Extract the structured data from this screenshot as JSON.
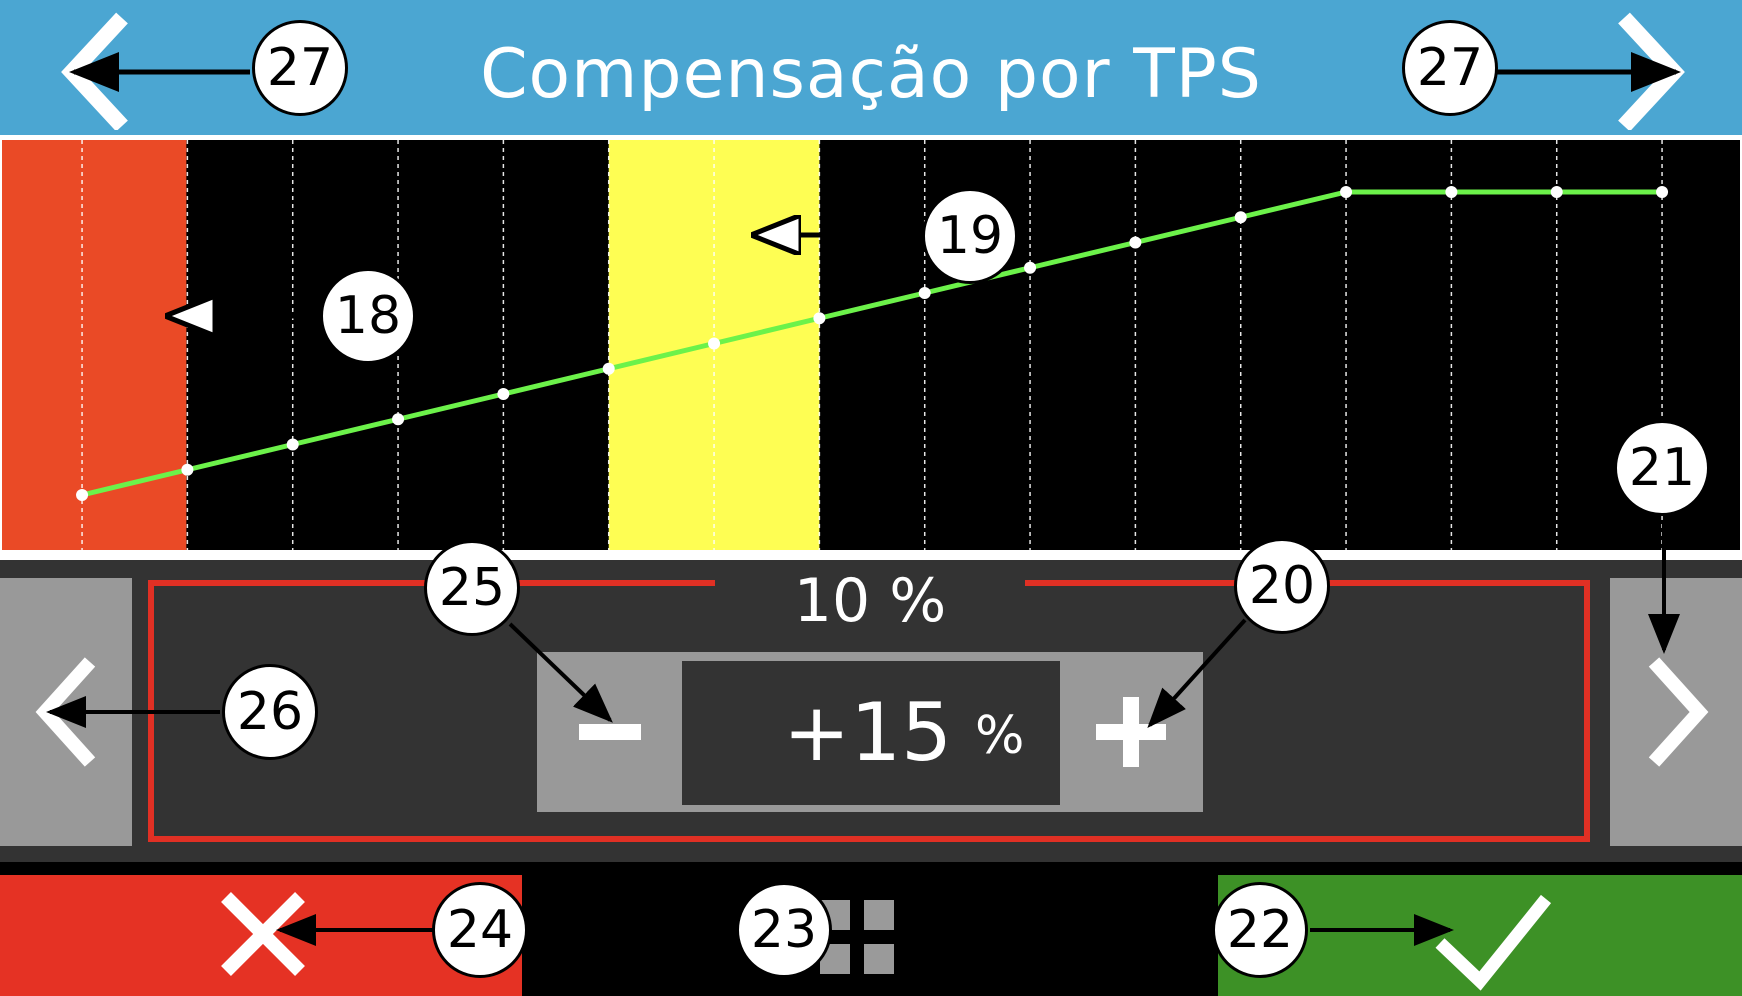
{
  "header": {
    "title": "Compensação por TPS",
    "background": "#4ba6d2"
  },
  "chart_data": {
    "type": "line",
    "title": "",
    "x": [
      0,
      1,
      2,
      3,
      4,
      5,
      6,
      7,
      8,
      9,
      10,
      11,
      12,
      13,
      14,
      15
    ],
    "values": [
      0,
      5,
      10,
      15,
      20,
      25,
      30,
      35,
      40,
      45,
      50,
      55,
      60,
      60,
      60,
      60
    ],
    "ylim": [
      0,
      60
    ],
    "grid": true,
    "highlight_red_columns": [
      0
    ],
    "highlight_yellow_columns": [
      5
    ],
    "line_color": "#6cf24a",
    "point_color": "#ffffff",
    "red_color": "#ea4a26",
    "yellow_color": "#fefe53"
  },
  "editor": {
    "column_value_label": "10 %",
    "value": "+15",
    "unit": "%",
    "minus_label": "−",
    "plus_label": "+"
  },
  "footer": {
    "cancel_color": "#e53224",
    "confirm_color": "#3d9126"
  },
  "callouts": {
    "c18": "18",
    "c19": "19",
    "c20": "20",
    "c21": "21",
    "c22": "22",
    "c23": "23",
    "c24": "24",
    "c25": "25",
    "c26": "26",
    "c27_left": "27",
    "c27_right": "27"
  },
  "icons": {
    "prev_table": "chevron-left-icon",
    "next_table": "chevron-right-icon",
    "prev_point": "chevron-left-icon",
    "next_point": "chevron-right-icon",
    "cancel": "close-icon",
    "confirm": "check-icon",
    "menu": "grid-menu-icon"
  }
}
